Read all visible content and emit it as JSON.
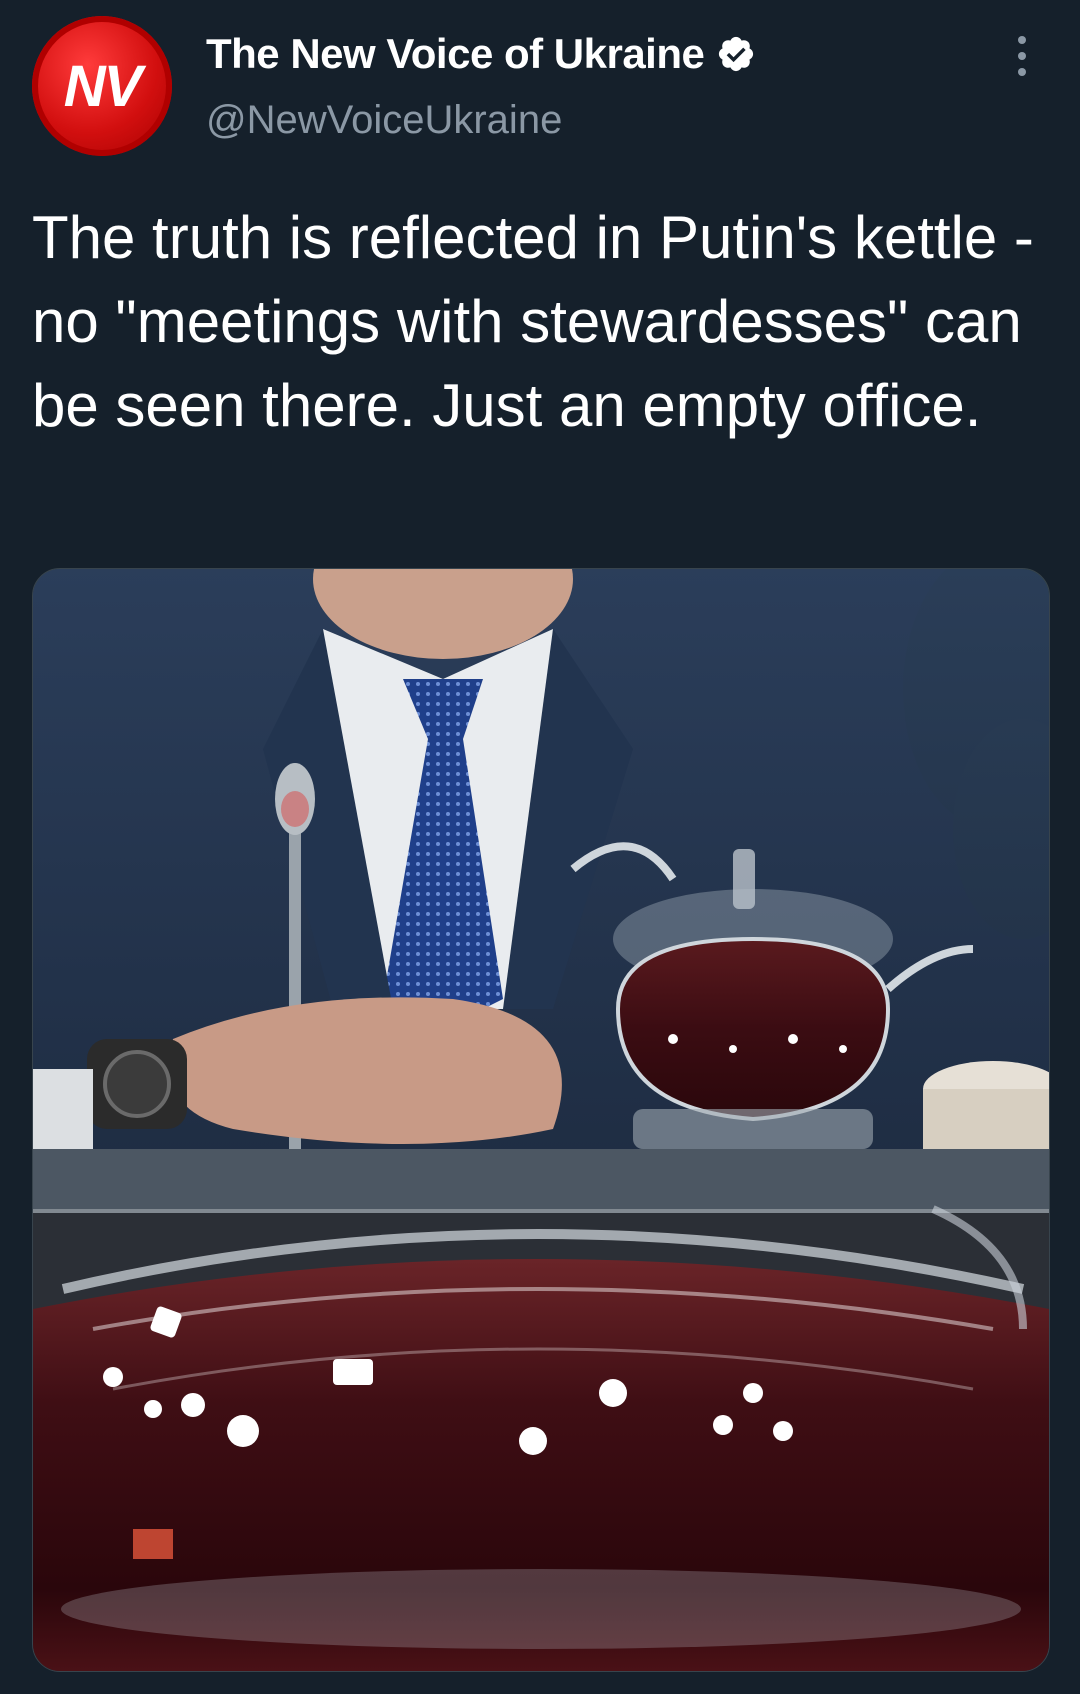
{
  "author": {
    "avatar_initials": "NV",
    "display_name": "The New Voice of Ukraine",
    "handle": "@NewVoiceUkraine",
    "verified_icon": "verified-badge-icon"
  },
  "tweet": {
    "text": "The truth is reflected in Putin's kettle - no \"meetings with stewardesses\" can be seen there. Just an empty office."
  },
  "icons": {
    "more": "more-vertical-icon"
  },
  "colors": {
    "background": "#15202b",
    "text_primary": "#ffffff",
    "text_secondary": "#8b98a5",
    "avatar_red": "#d20f0f"
  }
}
